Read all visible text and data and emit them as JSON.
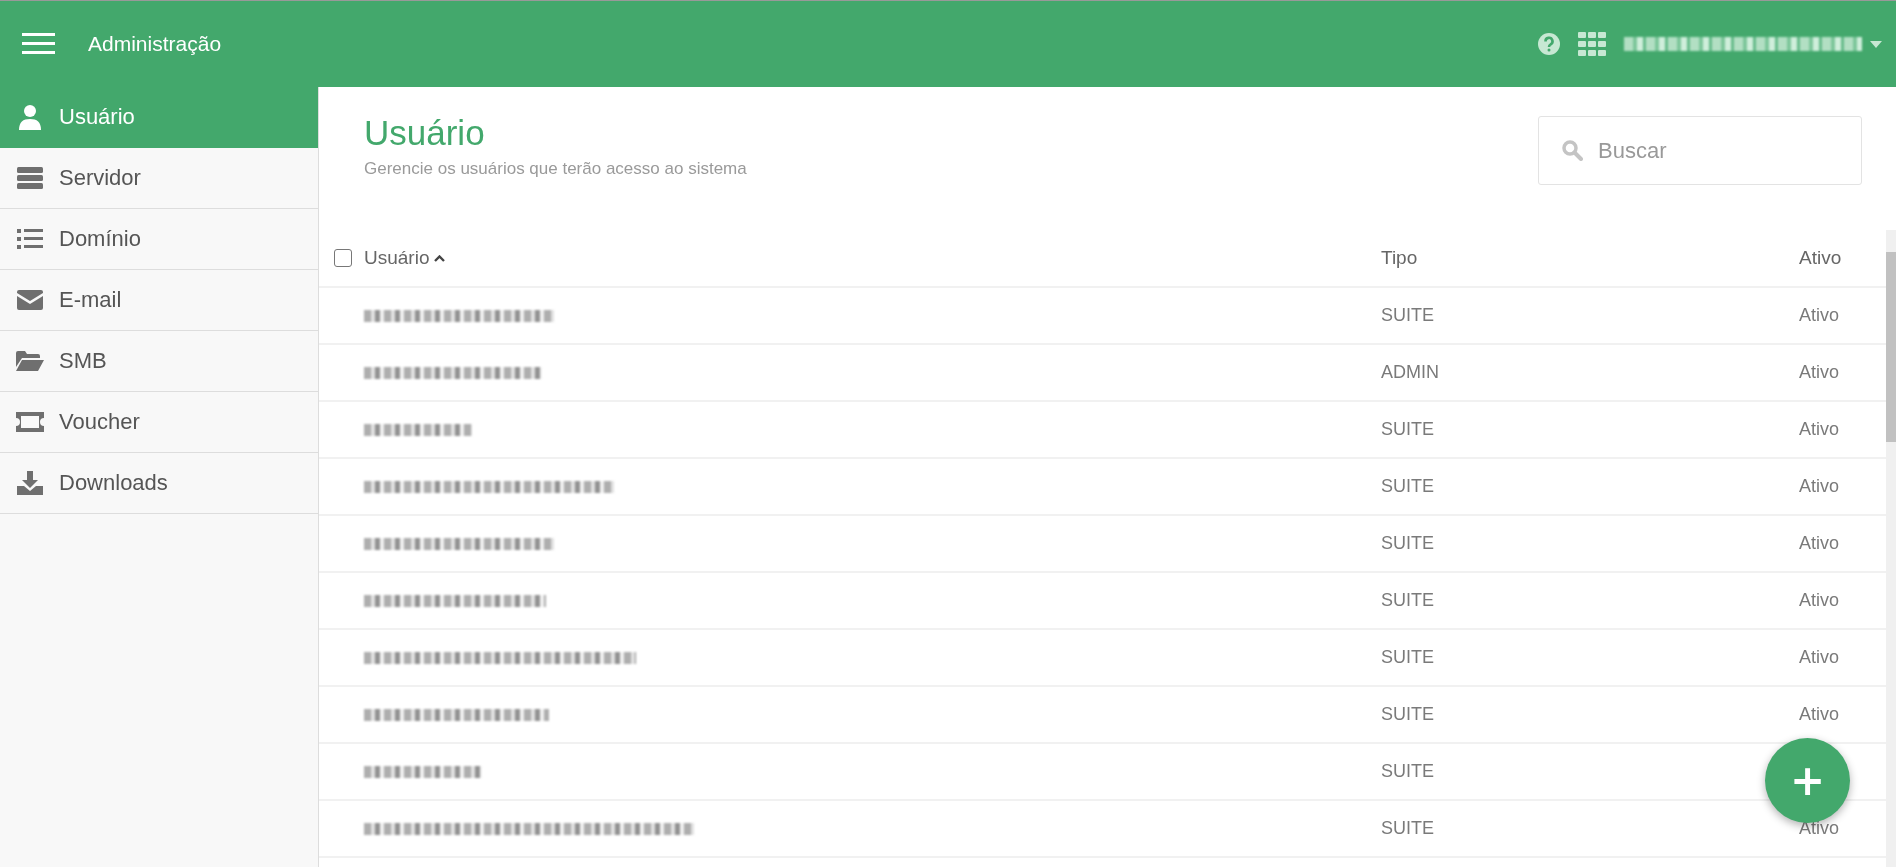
{
  "header": {
    "title": "Administração"
  },
  "sidebar": {
    "items": [
      {
        "label": "Usuário",
        "selected": true
      },
      {
        "label": "Servidor",
        "selected": false
      },
      {
        "label": "Domínio",
        "selected": false
      },
      {
        "label": "E-mail",
        "selected": false
      },
      {
        "label": "SMB",
        "selected": false
      },
      {
        "label": "Voucher",
        "selected": false
      },
      {
        "label": "Downloads",
        "selected": false
      }
    ]
  },
  "page": {
    "title": "Usuário",
    "subtitle": "Gerencie os usuários que terão acesso ao sistema",
    "search": {
      "placeholder": "Buscar"
    }
  },
  "table": {
    "select_all": {
      "checked": false
    },
    "columns": [
      {
        "label": "Usuário",
        "sort_ascending": true
      },
      {
        "label": "Tipo"
      },
      {
        "label": "Ativo"
      }
    ],
    "rows": [
      {
        "tipo": "SUITE",
        "ativo": "Ativo"
      },
      {
        "tipo": "ADMIN",
        "ativo": "Ativo"
      },
      {
        "tipo": "SUITE",
        "ativo": "Ativo"
      },
      {
        "tipo": "SUITE",
        "ativo": "Ativo"
      },
      {
        "tipo": "SUITE",
        "ativo": "Ativo"
      },
      {
        "tipo": "SUITE",
        "ativo": "Ativo"
      },
      {
        "tipo": "SUITE",
        "ativo": "Ativo"
      },
      {
        "tipo": "SUITE",
        "ativo": "Ativo"
      },
      {
        "tipo": "SUITE"
      },
      {
        "tipo": "SUITE",
        "ativo": "Ativo"
      }
    ]
  },
  "fab": {
    "label": "+"
  }
}
